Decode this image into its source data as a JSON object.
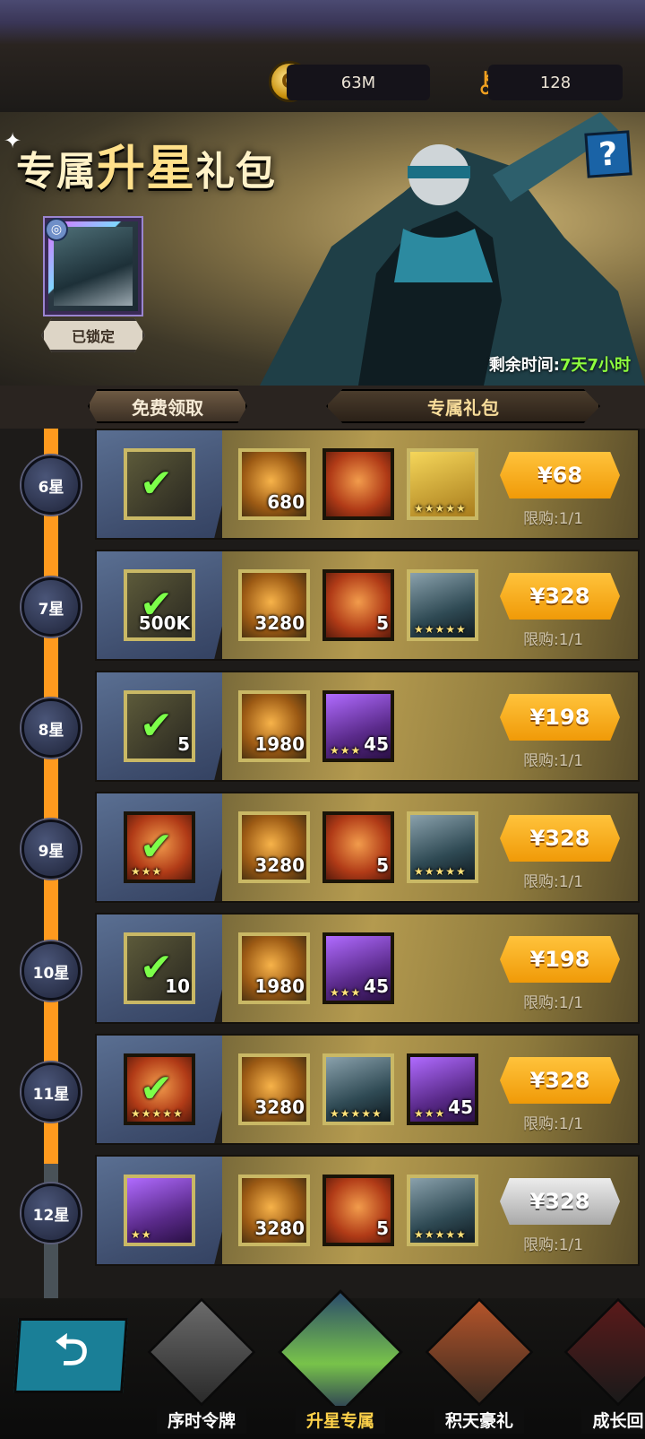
{
  "header": {
    "gold_value": "63M",
    "key_value": "128"
  },
  "banner": {
    "title_small_1": "专属",
    "title_big": "升星",
    "title_small_2": "礼包",
    "help_label": "?",
    "lock_label": "已锁定",
    "timer_label": "剩余时间:",
    "timer_value": "7天7小时"
  },
  "tabs": [
    {
      "label": "免费领取"
    },
    {
      "label": "专属礼包"
    }
  ],
  "rows": [
    {
      "star": "6星",
      "free_qty": "",
      "items": [
        {
          "qty": "680"
        },
        {
          "qty": ""
        },
        {
          "qty": ""
        }
      ],
      "price": "¥68",
      "limit": "限购:1/1"
    },
    {
      "star": "7星",
      "free_qty": "500K",
      "items": [
        {
          "qty": "3280"
        },
        {
          "qty": "5"
        },
        {
          "qty": ""
        }
      ],
      "price": "¥328",
      "limit": "限购:1/1"
    },
    {
      "star": "8星",
      "free_qty": "5",
      "items": [
        {
          "qty": "1980"
        },
        {
          "qty": "45"
        }
      ],
      "price": "¥198",
      "limit": "限购:1/1"
    },
    {
      "star": "9星",
      "free_qty": "",
      "items": [
        {
          "qty": "3280"
        },
        {
          "qty": "5"
        },
        {
          "qty": ""
        }
      ],
      "price": "¥328",
      "limit": "限购:1/1"
    },
    {
      "star": "10星",
      "free_qty": "10",
      "items": [
        {
          "qty": "1980"
        },
        {
          "qty": "45"
        }
      ],
      "price": "¥198",
      "limit": "限购:1/1"
    },
    {
      "star": "11星",
      "free_qty": "",
      "items": [
        {
          "qty": "3280"
        },
        {
          "qty": ""
        },
        {
          "qty": "45"
        }
      ],
      "price": "¥328",
      "limit": "限购:1/1"
    },
    {
      "star": "12星",
      "free_qty": "",
      "items": [
        {
          "qty": "3280"
        },
        {
          "qty": "5"
        },
        {
          "qty": ""
        }
      ],
      "price": "¥328",
      "limit": "限购:1/1"
    }
  ],
  "nav": [
    {
      "label": "序时令牌"
    },
    {
      "label": "升星专属"
    },
    {
      "label": "积天豪礼"
    },
    {
      "label": "成长回"
    }
  ],
  "colors": {
    "accent_orange": "#ff9a1e",
    "price_gold": "#f09a08",
    "timer_green": "#8eff3e"
  }
}
